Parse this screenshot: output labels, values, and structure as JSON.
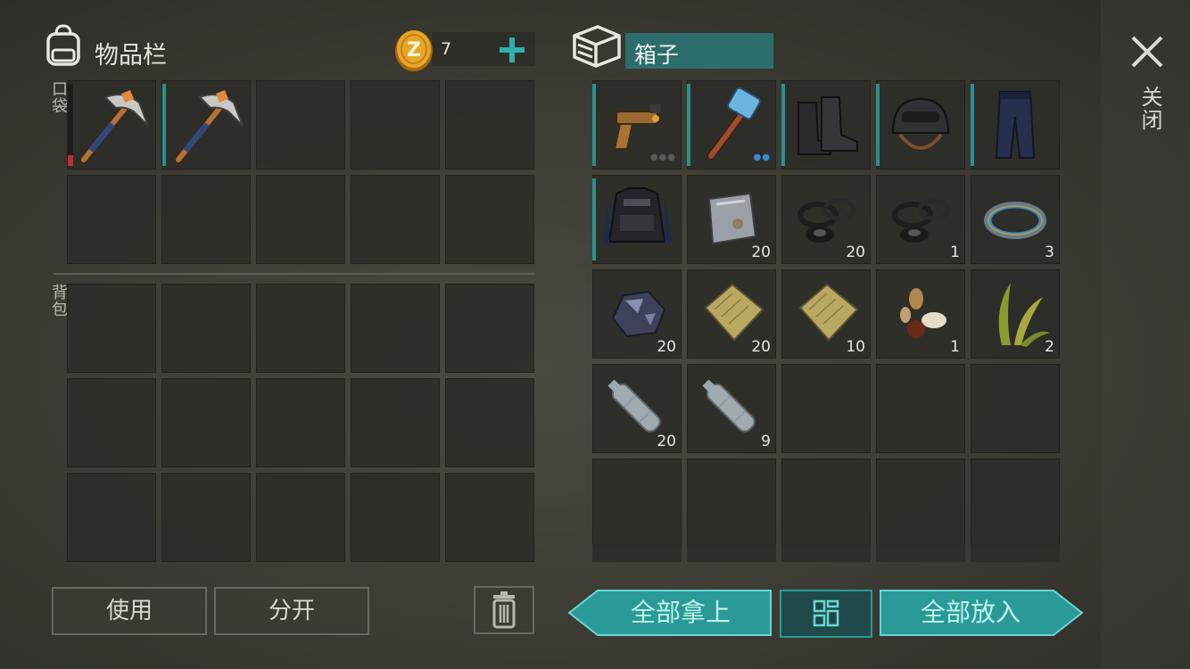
{
  "inventory": {
    "title": "物品栏",
    "coins": "7",
    "pocket_label": "口袋",
    "backpack_label": "背包"
  },
  "box": {
    "title": "箱子",
    "close_label": "关闭"
  },
  "pocket_slots": [
    {
      "item": "pickaxe-icon",
      "count": "",
      "durability_low": true
    },
    {
      "item": "pickaxe-icon",
      "count": ""
    }
  ],
  "box_slots": [
    {
      "item": "pistol-icon",
      "count": ""
    },
    {
      "item": "hammer-icon",
      "count": ""
    },
    {
      "item": "boots-icon",
      "count": ""
    },
    {
      "item": "helmet-icon",
      "count": ""
    },
    {
      "item": "pants-icon",
      "count": ""
    },
    {
      "item": "vest-icon",
      "count": ""
    },
    {
      "item": "metal-plate-icon",
      "count": "20"
    },
    {
      "item": "rubber-rings-icon",
      "count": "20"
    },
    {
      "item": "rubber-rings-icon",
      "count": "1"
    },
    {
      "item": "wire-coil-icon",
      "count": "3"
    },
    {
      "item": "ore-icon",
      "count": "20"
    },
    {
      "item": "cloth-icon",
      "count": "20"
    },
    {
      "item": "cloth-icon",
      "count": "10"
    },
    {
      "item": "seeds-icon",
      "count": "1"
    },
    {
      "item": "plant-fiber-icon",
      "count": "2"
    },
    {
      "item": "water-bottle-icon",
      "count": "20"
    },
    {
      "item": "water-bottle-icon",
      "count": "9"
    }
  ],
  "buttons": {
    "use": "使用",
    "split": "分开",
    "take_all": "全部拿上",
    "put_all": "全部放入"
  },
  "colors": {
    "accent_teal": "#2a9a98",
    "durability_red": "#c03030",
    "coin_gold": "#e0a020"
  }
}
